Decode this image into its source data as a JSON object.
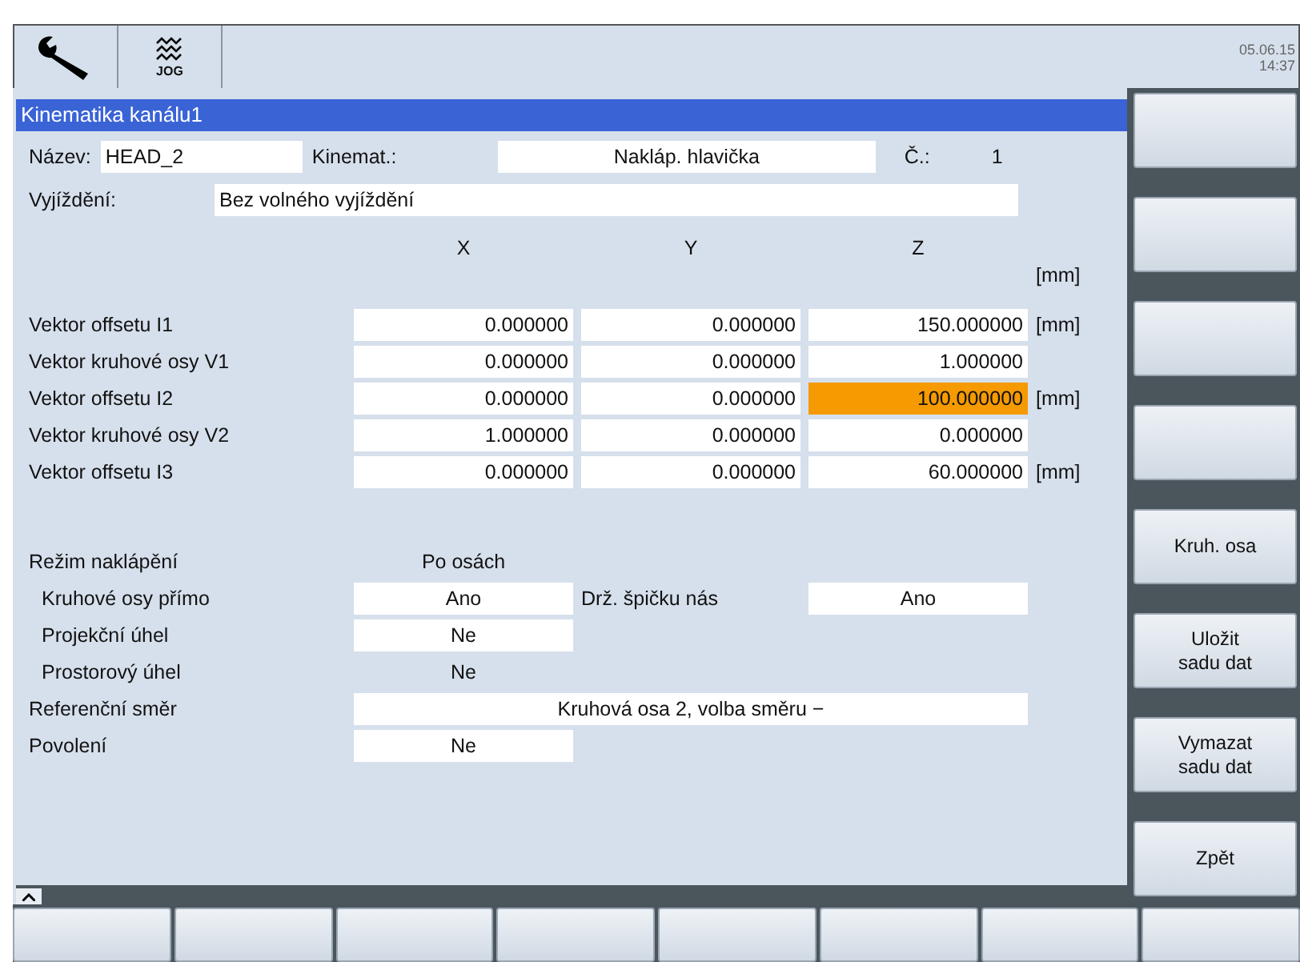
{
  "header": {
    "mode_label": "JOG",
    "date": "05.06.15",
    "time": "14:37"
  },
  "title": "Kinematika kanálu1",
  "name_row": {
    "label": "Název:",
    "value": "HEAD_2",
    "kinematics_label": "Kinemat.:",
    "kinematics_value": "Nakláp. hlavička",
    "number_label": "Č.:",
    "number_value": "1"
  },
  "retract": {
    "label": "Vyjíždění:",
    "value": "Bez volného vyjíždění"
  },
  "columns": [
    "X",
    "Y",
    "Z"
  ],
  "unit_header": "[mm]",
  "rows": [
    {
      "label": "Vektor offsetu I1",
      "unit": "[mm]",
      "cells": [
        {
          "value": "0.000000",
          "selected": false
        },
        {
          "value": "0.000000",
          "selected": false
        },
        {
          "value": "150.000000",
          "selected": false
        }
      ]
    },
    {
      "label": "Vektor kruhové osy V1",
      "cells": [
        {
          "value": "0.000000",
          "selected": false
        },
        {
          "value": "0.000000",
          "selected": false
        },
        {
          "value": "1.000000",
          "selected": false
        }
      ]
    },
    {
      "label": "Vektor offsetu I2",
      "unit": "[mm]",
      "cells": [
        {
          "value": "0.000000",
          "selected": false
        },
        {
          "value": "0.000000",
          "selected": false
        },
        {
          "value": "100.000000",
          "selected": true
        }
      ]
    },
    {
      "label": "Vektor kruhové osy V2",
      "cells": [
        {
          "value": "1.000000",
          "selected": false
        },
        {
          "value": "0.000000",
          "selected": false
        },
        {
          "value": "0.000000",
          "selected": false
        }
      ]
    },
    {
      "label": "Vektor offsetu I3",
      "unit": "[mm]",
      "cells": [
        {
          "value": "0.000000",
          "selected": false
        },
        {
          "value": "0.000000",
          "selected": false
        },
        {
          "value": "60.000000",
          "selected": false
        }
      ]
    }
  ],
  "settings": [
    {
      "label": "Režim naklápění",
      "kind": "plain",
      "value": "Po osách",
      "children": [
        {
          "label": "Kruhové osy přímo",
          "kind": "field",
          "value": "Ano",
          "side_label": "Drž. špičku nás",
          "side_value": "Ano"
        },
        {
          "label": "Projekční úhel",
          "kind": "field",
          "value": "Ne"
        },
        {
          "label": "Prostorový úhel",
          "kind": "plain",
          "value": "Ne"
        }
      ]
    },
    {
      "label": "Referenční směr",
      "kind": "wide",
      "value": "Kruhová osa 2, volba směru −"
    },
    {
      "label": "Povolení",
      "kind": "field",
      "value": "Ne"
    }
  ],
  "vertical_softkeys": [
    {
      "kind": "blank"
    },
    {
      "kind": "blank"
    },
    {
      "kind": "blank"
    },
    {
      "kind": "blank"
    },
    {
      "kind": "labeled",
      "label": "Kruh. osa"
    },
    {
      "kind": "labeled",
      "label": "Uložit\nsadu dat"
    },
    {
      "kind": "labeled",
      "label": "Vymazat\nsadu dat"
    },
    {
      "kind": "labeled",
      "label": "Zpět"
    }
  ],
  "horizontal_softkeys": [
    {
      "kind": "blank"
    },
    {
      "kind": "blank"
    },
    {
      "kind": "blank"
    },
    {
      "kind": "blank"
    },
    {
      "kind": "blank"
    },
    {
      "kind": "blank"
    },
    {
      "kind": "blank"
    },
    {
      "kind": "blank"
    }
  ]
}
